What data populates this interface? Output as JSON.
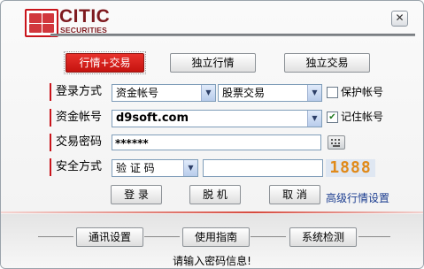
{
  "header": {
    "brand_name": "CITIC",
    "brand_sub": "SECURITIES",
    "close_label": "✕"
  },
  "mode_tabs": [
    {
      "label": "行情+交易",
      "active": true
    },
    {
      "label": "独立行情",
      "active": false
    },
    {
      "label": "独立交易",
      "active": false
    }
  ],
  "form": {
    "login_method": {
      "label": "登录方式",
      "account_type": "资金帐号",
      "trade_type": "股票交易",
      "protect_label": "保护帐号",
      "protect_checked": false
    },
    "account": {
      "label": "资金帐号",
      "value": "d9soft.com",
      "remember_label": "记住帐号",
      "remember_checked": true
    },
    "password": {
      "label": "交易密码",
      "value": "******"
    },
    "security": {
      "label": "安全方式",
      "method": "验 证 码",
      "captcha": "1888",
      "input_value": ""
    }
  },
  "actions": {
    "login": "登 录",
    "offline": "脱 机",
    "cancel": "取 消",
    "advanced_link": "高级行情设置"
  },
  "footer": {
    "buttons": [
      "通讯设置",
      "使用指南",
      "系统检测"
    ],
    "status": "请输入密码信息!"
  }
}
